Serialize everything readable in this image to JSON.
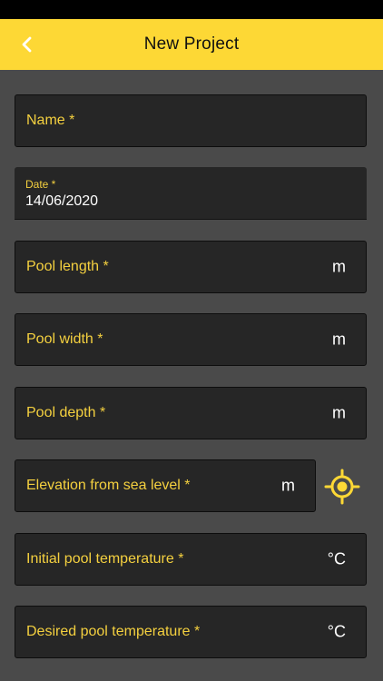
{
  "header": {
    "title": "New Project"
  },
  "form": {
    "name_label": "Name *",
    "date_label": "Date *",
    "date_value": "14/06/2020",
    "pool_length_label": "Pool length *",
    "pool_length_unit": "m",
    "pool_width_label": "Pool width *",
    "pool_width_unit": "m",
    "pool_depth_label": "Pool depth *",
    "pool_depth_unit": "m",
    "elevation_label": "Elevation from sea level *",
    "elevation_unit": "m",
    "initial_temp_label": "Initial pool temperature *",
    "initial_temp_unit": "°C",
    "desired_temp_label": "Desired pool temperature *",
    "desired_temp_unit": "°C"
  },
  "icons": {
    "back": "chevron-left-icon",
    "locate": "crosshair-location-icon"
  },
  "colors": {
    "accent": "#fdd835",
    "label": "#f4d03f",
    "background": "#4a4a4a",
    "field": "#262626"
  }
}
